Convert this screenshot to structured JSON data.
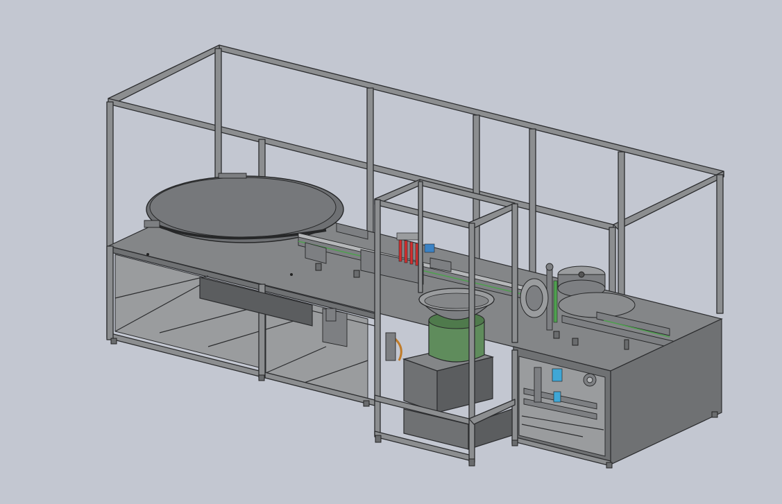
{
  "view": {
    "background": "#c3c7d1",
    "frame_color": "#8c8e90",
    "panel_color": "#848688",
    "hopper_bowl_color": "#5f8c5c",
    "accent_colors": [
      "#d22f2f",
      "#3b82c4",
      "#3fa7d6",
      "#4fa04f"
    ]
  },
  "components": [
    {
      "name": "outer-frame",
      "icon": "frame-icon"
    },
    {
      "name": "rotary-turntable",
      "icon": "turntable-icon"
    },
    {
      "name": "conveyor",
      "icon": "conveyor-icon"
    },
    {
      "name": "vibratory-bowl-feeder",
      "icon": "bowl-feeder-icon"
    },
    {
      "name": "capping-station",
      "icon": "capper-icon"
    },
    {
      "name": "drive-mechanism",
      "icon": "gear-icon"
    }
  ]
}
